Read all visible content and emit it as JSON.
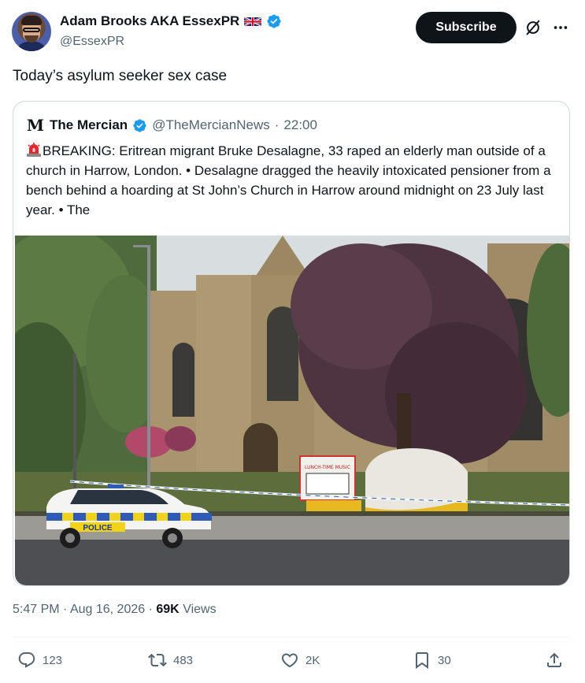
{
  "author": {
    "display_name": "Adam Brooks AKA EssexPR",
    "handle": "@EssexPR",
    "flag_icon": "uk-flag-icon",
    "verified_icon": "verified-badge-icon"
  },
  "header_actions": {
    "subscribe_label": "Subscribe",
    "grok_icon": "grok-icon",
    "more_icon": "more-icon"
  },
  "tweet": {
    "text": "Today’s asylum seeker sex case"
  },
  "quoted": {
    "logo_letter": "M",
    "name": "The Mercian",
    "handle": "@TheMercianNews",
    "separator": "·",
    "time": "22:00",
    "emoji_icon": "siren-icon",
    "text": "BREAKING: Eritrean migrant Bruke Desalagne, 33 raped an elderly man outside of a church in Harrow, London. • Desalagne dragged the heavily intoxicated pensioner from a bench behind a hoarding at St John’s Church in Harrow around midnight on 23 July last year. • The",
    "image": {
      "police_label": "POLICE",
      "sign_label": "LUNCH-TIME MUSIC"
    }
  },
  "meta": {
    "time": "5:47 PM",
    "dot1": "·",
    "date": "Aug 16, 2026",
    "dot2": "·",
    "views_count": "69K",
    "views_label": "Views"
  },
  "actions": {
    "replies": "123",
    "reposts": "483",
    "likes": "2K",
    "bookmarks": "30"
  },
  "colors": {
    "text": "#0f1419",
    "secondary": "#536471",
    "border": "#cfd9de",
    "verified_blue": "#1d9bf0",
    "button_bg": "#0f1419"
  }
}
